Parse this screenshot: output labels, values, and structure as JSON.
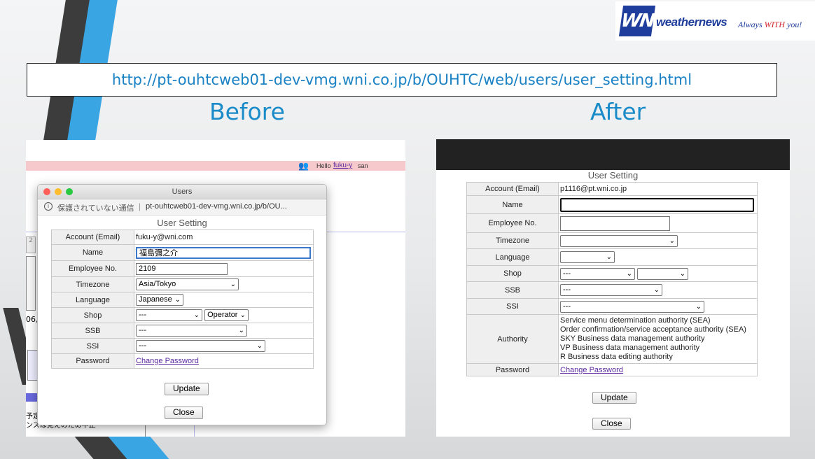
{
  "logo": {
    "mark": "WNI",
    "brand": "weathernews",
    "tagline_pre": "Always ",
    "tagline_with": "WITH",
    "tagline_post": " you!"
  },
  "url": "http://pt-ouhtcweb01-dev-vmg.wni.co.jp/b/OUHTC/web/users/user_setting.html",
  "before": {
    "heading": "Before",
    "page_header": {
      "greeting": "Hello",
      "user": "fuku-y",
      "suffix": "san"
    },
    "window": {
      "title": "Users",
      "security_label": "保護されていない通信",
      "address": "pt-ouhtcweb01-dev-vmg.wni.co.jp/b/OU...",
      "page_title": "User Setting",
      "rows": {
        "account": {
          "label": "Account (Email)",
          "value": "fuku-y@wni.com"
        },
        "name": {
          "label": "Name",
          "value": "福島彌之介"
        },
        "employee": {
          "label": "Employee No.",
          "value": "2109"
        },
        "timezone": {
          "label": "Timezone",
          "value": "Asia/Tokyo"
        },
        "language": {
          "label": "Language",
          "value": "Japanese"
        },
        "shop": {
          "label": "Shop",
          "value": "---",
          "value2": "Operator"
        },
        "ssb": {
          "label": "SSB",
          "value": "---"
        },
        "ssi": {
          "label": "SSI",
          "value": "---"
        },
        "password": {
          "label": "Password",
          "link": "Change Password"
        }
      },
      "update_label": "Update",
      "close_label": "Close"
    },
    "bg_fragments": {
      "tab": "2",
      "date": "06,",
      "jp1": "予定",
      "jp2": "ンスは見えのため中止"
    }
  },
  "after": {
    "heading": "After",
    "page_title": "User Setting",
    "rows": {
      "account": {
        "label": "Account (Email)",
        "value": "p1116@pt.wni.co.jp"
      },
      "name": {
        "label": "Name",
        "value": ""
      },
      "employee": {
        "label": "Employee No.",
        "value": ""
      },
      "timezone": {
        "label": "Timezone",
        "value": ""
      },
      "language": {
        "label": "Language",
        "value": ""
      },
      "shop": {
        "label": "Shop",
        "value": "---",
        "value2": ""
      },
      "ssb": {
        "label": "SSB",
        "value": "---"
      },
      "ssi": {
        "label": "SSI",
        "value": "---"
      },
      "authority": {
        "label": "Authority",
        "items": [
          "Service menu determination authority (SEA)",
          "Order confirmation/service acceptance authority (SEA)",
          "SKY Business data management authority",
          "VP Business data management authority",
          "R Business data editing authority"
        ]
      },
      "password": {
        "label": "Password",
        "link": "Change Password"
      }
    },
    "update_label": "Update",
    "close_label": "Close"
  },
  "colors": {
    "accent": "#1a8bc9",
    "brand": "#1f3d9c",
    "header_pink": "#f6c9cc",
    "dark_bar": "#222222"
  }
}
